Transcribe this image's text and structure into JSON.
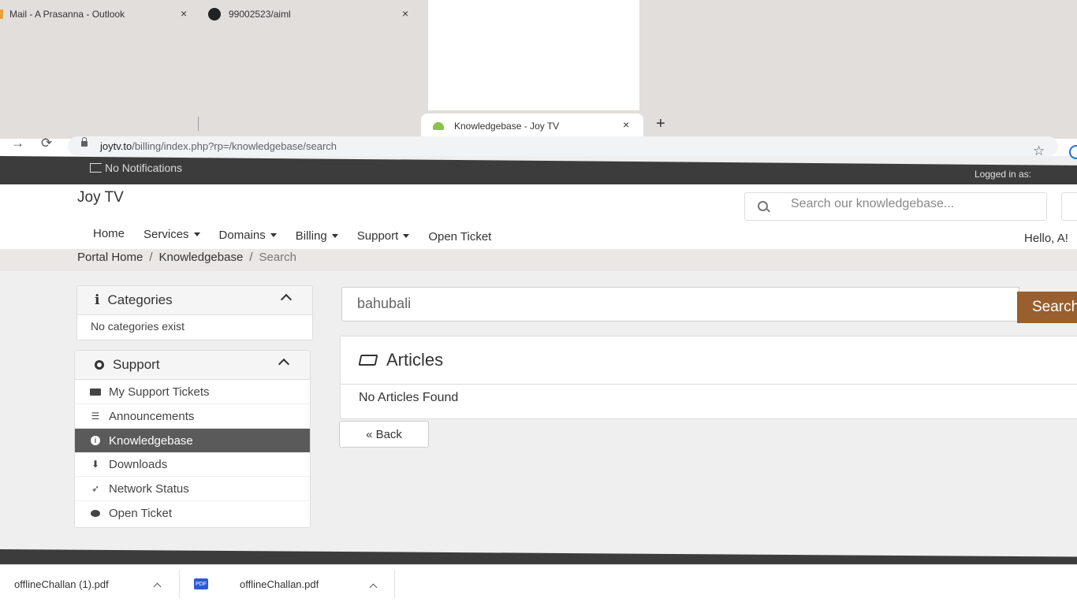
{
  "browser": {
    "tabs": [
      {
        "title": "Mail - A Prasanna - Outlook",
        "close": "×"
      },
      {
        "title": "99002523/aiml",
        "close": "×"
      },
      {
        "title": "Knowledgebase - Joy TV",
        "close": "×"
      }
    ],
    "new_tab": "+",
    "url_host": "joytv.to",
    "url_path": "/billing/index.php?rp=/knowledgebase/search"
  },
  "topbar": {
    "notifications": "No Notifications",
    "logged_in": "Logged in as:"
  },
  "header": {
    "brand": "Joy TV",
    "search_placeholder": "Search our knowledgebase...",
    "hello": "Hello, A!"
  },
  "nav": [
    {
      "label": "Home",
      "dropdown": false
    },
    {
      "label": "Services",
      "dropdown": true
    },
    {
      "label": "Domains",
      "dropdown": true
    },
    {
      "label": "Billing",
      "dropdown": true
    },
    {
      "label": "Support",
      "dropdown": true
    },
    {
      "label": "Open Ticket",
      "dropdown": false
    }
  ],
  "breadcrumb": {
    "home": "Portal Home",
    "kb": "Knowledgebase",
    "current": "Search",
    "sep": "/"
  },
  "sidebar": {
    "categories": {
      "title": "Categories",
      "empty": "No categories exist"
    },
    "support": {
      "title": "Support",
      "items": [
        {
          "label": "My Support Tickets",
          "icon": "ticket-icon"
        },
        {
          "label": "Announcements",
          "icon": "list-icon"
        },
        {
          "label": "Knowledgebase",
          "icon": "info-icon",
          "active": true
        },
        {
          "label": "Downloads",
          "icon": "download-icon"
        },
        {
          "label": "Network Status",
          "icon": "rocket-icon"
        },
        {
          "label": "Open Ticket",
          "icon": "comments-icon"
        }
      ]
    }
  },
  "main": {
    "search_value": "bahubali",
    "search_button": "Search",
    "articles_title": "Articles",
    "no_articles": "No Articles Found",
    "back": "« Back"
  },
  "downloads": [
    {
      "name": "offlineChallan (1).pdf"
    },
    {
      "name": "offlineChallan.pdf"
    }
  ],
  "colors": {
    "accent": "#9a5f2e",
    "dark_bar": "#3c3c3c",
    "active_item": "#5a5a5a"
  }
}
